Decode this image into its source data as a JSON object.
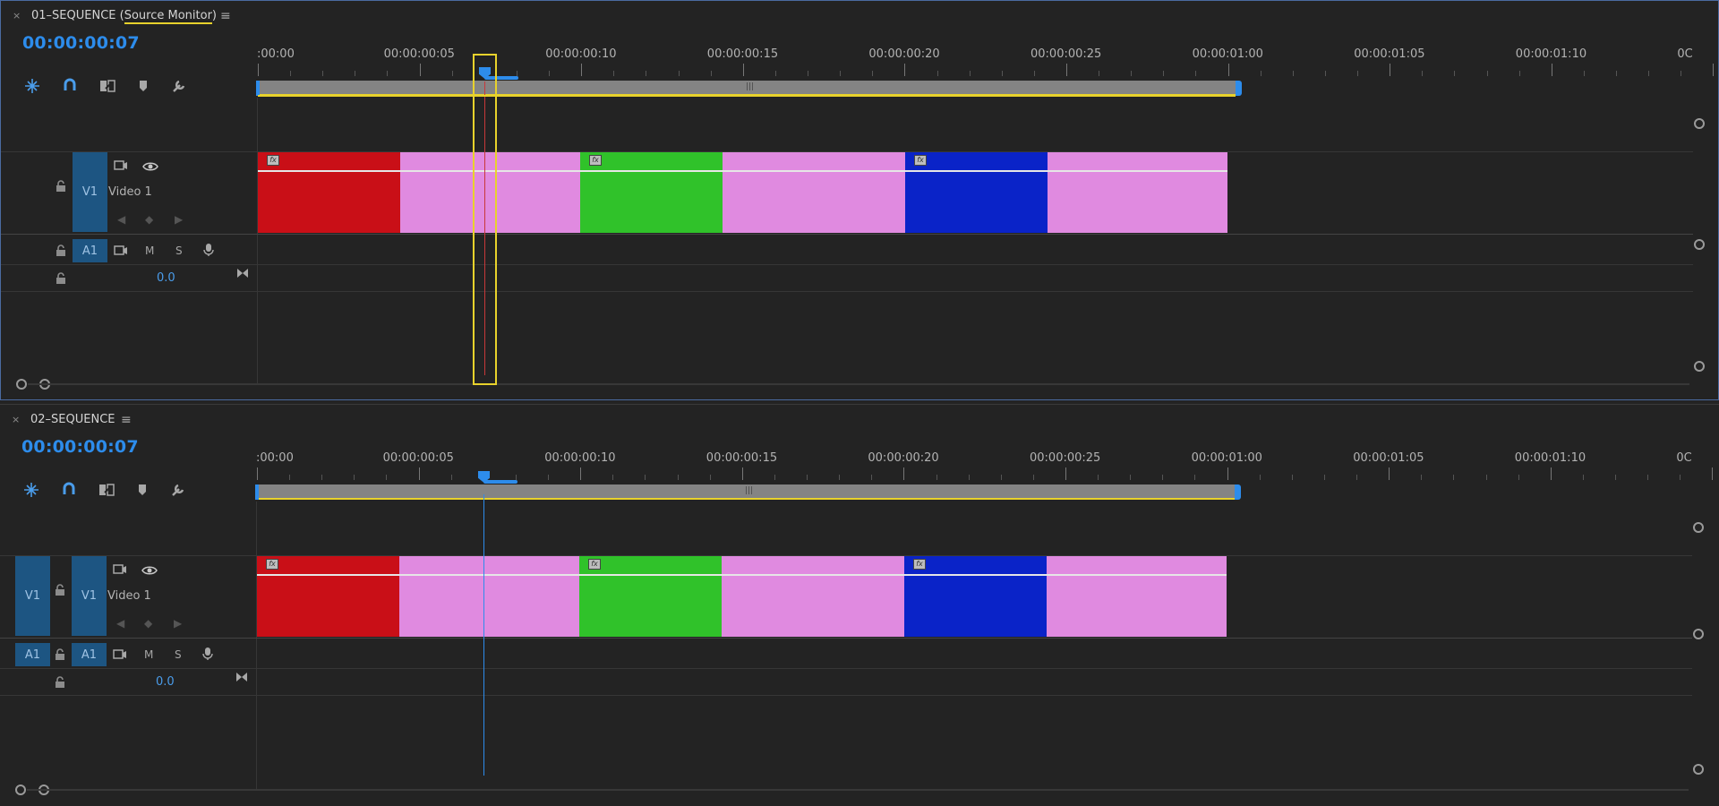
{
  "panels": [
    {
      "title": "01–SEQUENCE",
      "title_suffix": "Source Monitor",
      "menu_icon": "hamburger-icon",
      "timecode": "00:00:00:07",
      "tools": [
        "snap-icon",
        "magnet-icon",
        "linked-selection-icon",
        "marker-icon",
        "wrench-icon"
      ],
      "video_track": {
        "target": "",
        "label": "V1",
        "name": "Video 1"
      },
      "audio_track": {
        "target": "",
        "label": "A1",
        "mute": "M",
        "solo": "S",
        "volume": "0.0"
      }
    },
    {
      "title": "02–SEQUENCE",
      "menu_icon": "hamburger-icon",
      "timecode": "00:00:00:07",
      "tools": [
        "snap-icon",
        "magnet-icon",
        "linked-selection-icon",
        "marker-icon",
        "wrench-icon"
      ],
      "video_track": {
        "target": "V1",
        "label": "V1",
        "name": "Video 1"
      },
      "audio_track": {
        "target": "A1",
        "label": "A1",
        "mute": "M",
        "solo": "S",
        "volume": "0.0"
      }
    }
  ],
  "ruler_labels": [
    ":00:00",
    "00:00:00:05",
    "00:00:00:10",
    "00:00:00:15",
    "00:00:00:20",
    "00:00:00:25",
    "00:00:01:00",
    "00:00:01:05",
    "00:00:01:10",
    "0C"
  ],
  "clips": [
    {
      "color": "#c90f17",
      "fx": "fx"
    },
    {
      "color": "#e08ae0",
      "fx": ""
    },
    {
      "color": "#30c22a",
      "fx": "fx"
    },
    {
      "color": "#e08ae0",
      "fx": ""
    },
    {
      "color": "#0a23c8",
      "fx": "fx"
    },
    {
      "color": "#e08ae0",
      "fx": ""
    }
  ],
  "colors": {
    "accent": "#2d8ceb",
    "highlight": "#e8d22c",
    "track_target": "#1d5582",
    "playhead_red": "#c8383a"
  }
}
